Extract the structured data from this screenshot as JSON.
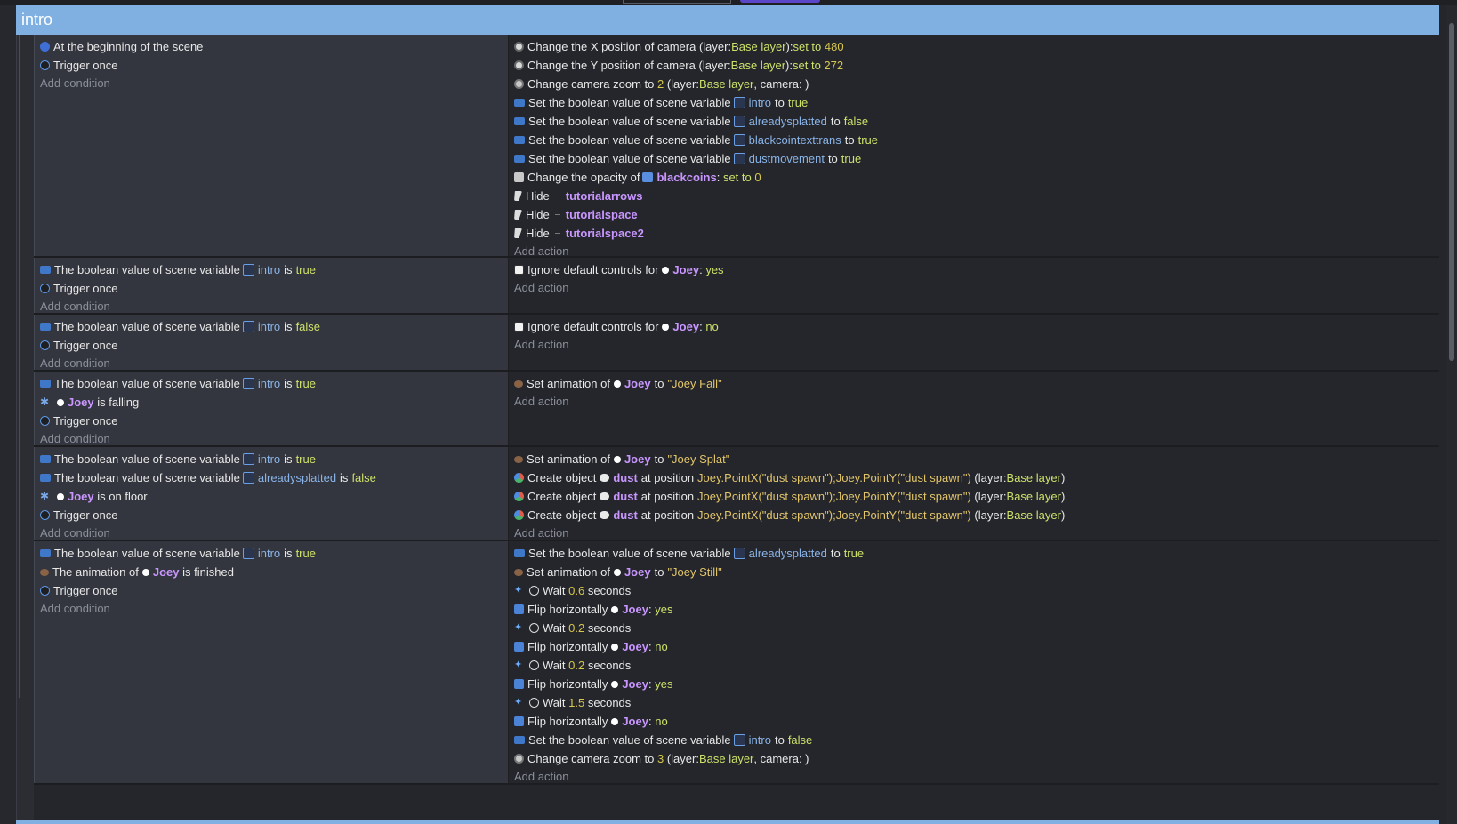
{
  "group": {
    "title": "intro"
  },
  "common": {
    "add_condition": "Add condition",
    "add_action": "Add action"
  },
  "events": [
    {
      "conditions": [
        {
          "icon": "scene-start-icon",
          "text": "At the beginning of the scene"
        },
        {
          "icon": "trigger-once-icon",
          "text": "Trigger once"
        }
      ],
      "actions": [
        {
          "icon": "camera-icon",
          "parts": [
            "Change the X position of camera",
            "(layer: ",
            "Base layer",
            "): ",
            "set to",
            "480"
          ]
        },
        {
          "icon": "camera-icon",
          "parts": [
            "Change the Y position of camera",
            "(layer: ",
            "Base layer",
            "): ",
            "set to",
            "272"
          ]
        },
        {
          "icon": "zoom-icon",
          "parts": [
            "Change camera zoom to",
            "2",
            "(layer: ",
            "Base layer",
            ", camera: )"
          ]
        },
        {
          "icon": "variable-icon",
          "parts": [
            "Set the boolean value of scene variable",
            "intro",
            "to",
            "true"
          ]
        },
        {
          "icon": "variable-icon",
          "parts": [
            "Set the boolean value of scene variable",
            "alreadysplatted",
            "to",
            "false"
          ]
        },
        {
          "icon": "variable-icon",
          "parts": [
            "Set the boolean value of scene variable",
            "blackcointexttrans",
            "to",
            "true"
          ]
        },
        {
          "icon": "variable-icon",
          "parts": [
            "Set the boolean value of scene variable",
            "dustmovement",
            "to",
            "true"
          ]
        },
        {
          "icon": "opacity-icon",
          "parts": [
            "Change the opacity of",
            "blackcoins",
            ":",
            "set to",
            "0"
          ]
        },
        {
          "icon": "hide-icon",
          "parts": [
            "Hide",
            "tutorialarrows"
          ]
        },
        {
          "icon": "hide-icon",
          "parts": [
            "Hide",
            "tutorialspace"
          ]
        },
        {
          "icon": "hide-icon",
          "parts": [
            "Hide",
            "tutorialspace2"
          ]
        }
      ]
    },
    {
      "conditions": [
        {
          "icon": "variable-icon",
          "parts": [
            "The boolean value of scene variable",
            "intro",
            "is",
            "true"
          ]
        },
        {
          "icon": "trigger-once-icon",
          "text": "Trigger once"
        }
      ],
      "actions": [
        {
          "icon": "controls-icon",
          "parts": [
            "Ignore default controls for",
            "Joey",
            ":",
            "yes"
          ]
        }
      ]
    },
    {
      "conditions": [
        {
          "icon": "variable-icon",
          "parts": [
            "The boolean value of scene variable",
            "intro",
            "is",
            "false"
          ]
        },
        {
          "icon": "trigger-once-icon",
          "text": "Trigger once"
        }
      ],
      "actions": [
        {
          "icon": "controls-icon",
          "parts": [
            "Ignore default controls for",
            "Joey",
            ":",
            "no"
          ]
        }
      ]
    },
    {
      "conditions": [
        {
          "icon": "variable-icon",
          "parts": [
            "The boolean value of scene variable",
            "intro",
            "is",
            "true"
          ]
        },
        {
          "icon": "platformer-icon",
          "parts": [
            "Joey",
            "is falling"
          ]
        },
        {
          "icon": "trigger-once-icon",
          "text": "Trigger once"
        }
      ],
      "actions": [
        {
          "icon": "animation-icon",
          "parts": [
            "Set animation of",
            "Joey",
            "to",
            "\"Joey Fall\""
          ]
        }
      ]
    },
    {
      "conditions": [
        {
          "icon": "variable-icon",
          "parts": [
            "The boolean value of scene variable",
            "intro",
            "is",
            "true"
          ]
        },
        {
          "icon": "variable-icon",
          "parts": [
            "The boolean value of scene variable",
            "alreadysplatted",
            "is",
            "false"
          ]
        },
        {
          "icon": "platformer-icon",
          "parts": [
            "Joey",
            "is on floor"
          ]
        },
        {
          "icon": "trigger-once-icon",
          "text": "Trigger once"
        }
      ],
      "actions": [
        {
          "icon": "animation-icon",
          "parts": [
            "Set animation of",
            "Joey",
            "to",
            "\"Joey Splat\""
          ]
        },
        {
          "icon": "create-object-icon",
          "parts": [
            "Create object",
            "dust",
            "at position",
            "Joey.PointX(\"dust spawn\");Joey.PointY(\"dust spawn\")",
            "(layer: ",
            "Base layer",
            ")"
          ]
        },
        {
          "icon": "create-object-icon",
          "parts": [
            "Create object",
            "dust",
            "at position",
            "Joey.PointX(\"dust spawn\");Joey.PointY(\"dust spawn\")",
            "(layer: ",
            "Base layer",
            ")"
          ]
        },
        {
          "icon": "create-object-icon",
          "parts": [
            "Create object",
            "dust",
            "at position",
            "Joey.PointX(\"dust spawn\");Joey.PointY(\"dust spawn\")",
            "(layer: ",
            "Base layer",
            ")"
          ]
        }
      ]
    },
    {
      "conditions": [
        {
          "icon": "variable-icon",
          "parts": [
            "The boolean value of scene variable",
            "intro",
            "is",
            "true"
          ]
        },
        {
          "icon": "animation-icon",
          "parts": [
            "The animation of",
            "Joey",
            "is finished"
          ]
        },
        {
          "icon": "trigger-once-icon",
          "text": "Trigger once"
        }
      ],
      "actions": [
        {
          "icon": "variable-icon",
          "parts": [
            "Set the boolean value of scene variable",
            "alreadysplatted",
            "to",
            "true"
          ]
        },
        {
          "icon": "animation-icon",
          "parts": [
            "Set animation of",
            "Joey",
            "to",
            "\"Joey Still\""
          ]
        },
        {
          "icon": "wait-icon",
          "parts": [
            "Wait",
            "0.6",
            "seconds"
          ]
        },
        {
          "icon": "flip-icon",
          "parts": [
            "Flip horizontally",
            "Joey",
            ":",
            "yes"
          ]
        },
        {
          "icon": "wait-icon",
          "parts": [
            "Wait",
            "0.2",
            "seconds"
          ]
        },
        {
          "icon": "flip-icon",
          "parts": [
            "Flip horizontally",
            "Joey",
            ":",
            "no"
          ]
        },
        {
          "icon": "wait-icon",
          "parts": [
            "Wait",
            "0.2",
            "seconds"
          ]
        },
        {
          "icon": "flip-icon",
          "parts": [
            "Flip horizontally",
            "Joey",
            ":",
            "yes"
          ]
        },
        {
          "icon": "wait-icon",
          "parts": [
            "Wait",
            "1.5",
            "seconds"
          ]
        },
        {
          "icon": "flip-icon",
          "parts": [
            "Flip horizontally",
            "Joey",
            ":",
            "no"
          ]
        },
        {
          "icon": "variable-icon",
          "parts": [
            "Set the boolean value of scene variable",
            "intro",
            "to",
            "false"
          ]
        },
        {
          "icon": "zoom-icon",
          "parts": [
            "Change camera zoom to",
            "3",
            "(layer: ",
            "Base layer",
            ", camera: )"
          ]
        }
      ]
    }
  ]
}
